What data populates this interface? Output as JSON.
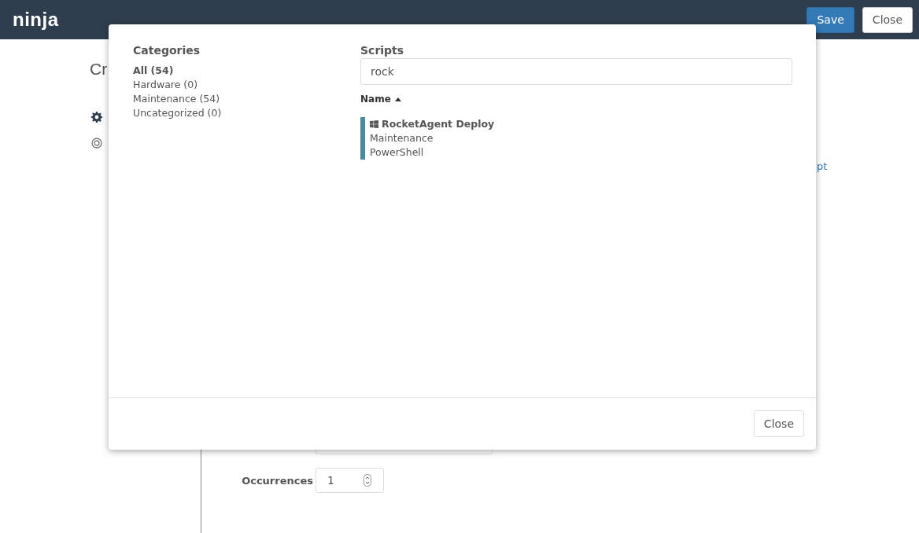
{
  "header": {
    "logo": "ninja",
    "buttons": [
      {
        "label": "Save",
        "kind": "primary"
      },
      {
        "label": "Close",
        "kind": "default"
      }
    ]
  },
  "page": {
    "title": "Cr",
    "link": "pt",
    "occurrences": {
      "label": "Occurrences",
      "value": "1"
    }
  },
  "modal": {
    "categories": {
      "heading": "Categories",
      "items": [
        {
          "label": "All (54)",
          "selected": true
        },
        {
          "label": "Hardware (0)",
          "selected": false
        },
        {
          "label": "Maintenance (54)",
          "selected": false
        },
        {
          "label": "Uncategorized (0)",
          "selected": false
        }
      ]
    },
    "scripts": {
      "heading": "Scripts",
      "search": {
        "value": "rock"
      },
      "sort_column": {
        "label": "Name",
        "sorted_ascending": true
      },
      "rows": [
        {
          "name": "RocketAgent Deploy",
          "category": "Maintenance",
          "language": "PowerShell",
          "selected": true
        }
      ]
    },
    "footer": {
      "close_button": "Close"
    }
  }
}
